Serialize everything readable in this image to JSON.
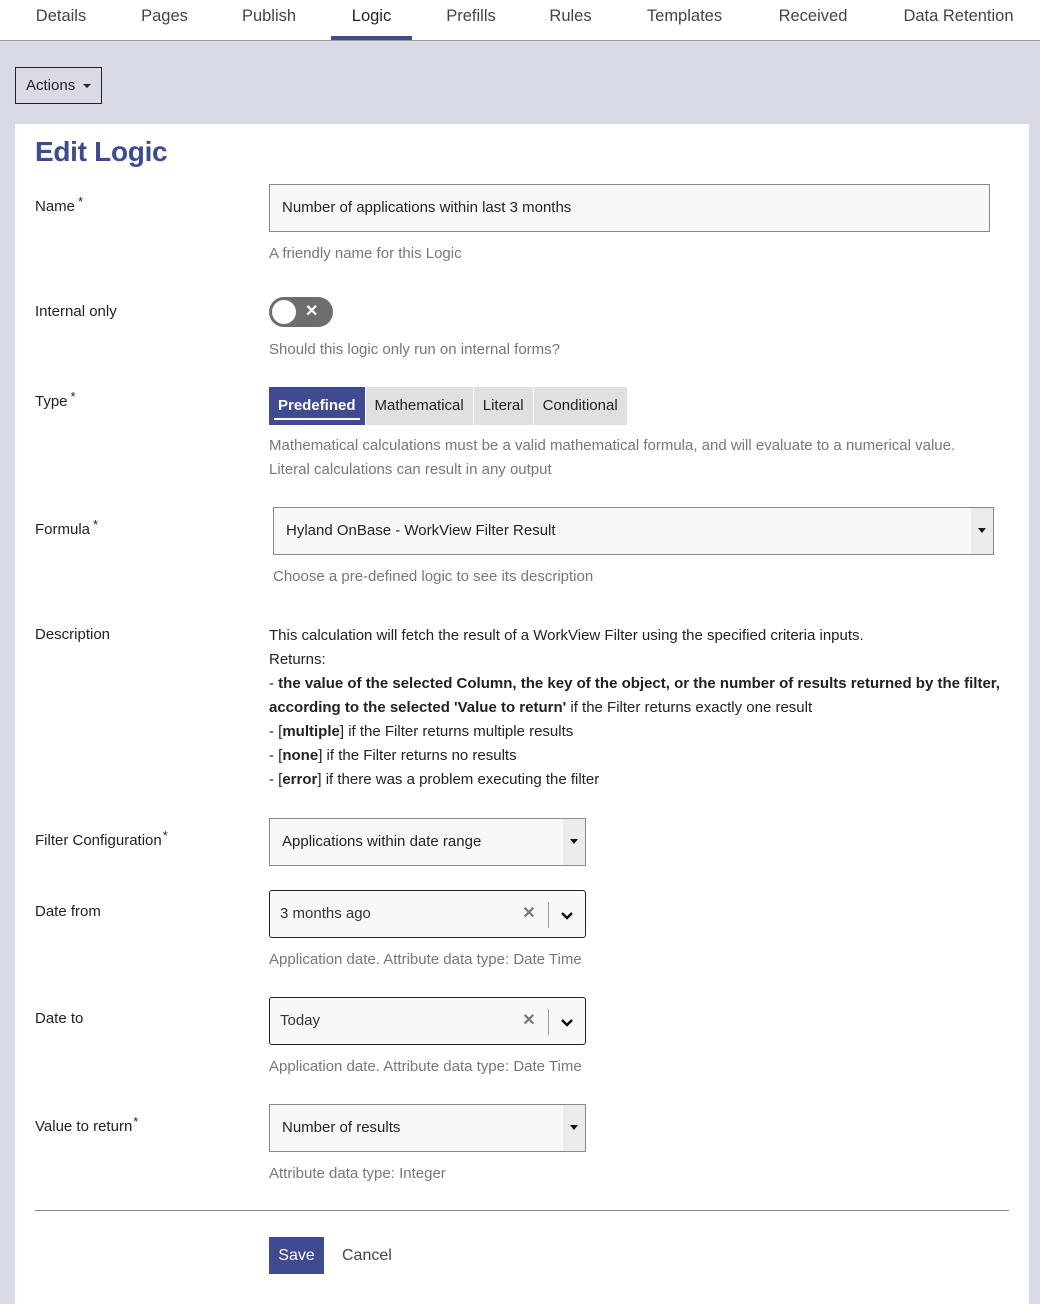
{
  "tabs": [
    {
      "label": "Details",
      "active": false
    },
    {
      "label": "Pages",
      "active": false
    },
    {
      "label": "Publish",
      "active": false
    },
    {
      "label": "Logic",
      "active": true
    },
    {
      "label": "Prefills",
      "active": false
    },
    {
      "label": "Rules",
      "active": false
    },
    {
      "label": "Templates",
      "active": false
    },
    {
      "label": "Received",
      "active": false
    },
    {
      "label": "Data Retention",
      "active": false
    }
  ],
  "actions_label": "Actions",
  "form": {
    "title": "Edit Logic",
    "required_marker": "*",
    "name": {
      "label": "Name",
      "value": "Number of applications within last 3 months",
      "help": "A friendly name for this Logic"
    },
    "internal_only": {
      "label": "Internal only",
      "checked": false,
      "off_glyph": "✕",
      "help": "Should this logic only run on internal forms?"
    },
    "type": {
      "label": "Type",
      "options": [
        "Predefined",
        "Mathematical",
        "Literal",
        "Conditional"
      ],
      "selected": "Predefined",
      "help_lines": [
        "Mathematical calculations must be a valid mathematical formula, and will evaluate to a numerical value.",
        "Literal calculations can result in any output"
      ]
    },
    "formula": {
      "label": "Formula",
      "value": "Hyland OnBase - WorkView Filter Result",
      "help": "Choose a pre-defined logic to see its description"
    },
    "description": {
      "label": "Description",
      "intro": "This calculation will fetch the result of a WorkView Filter using the specified criteria inputs.",
      "returns_label": "Returns:",
      "item1_bold": "the value of the selected Column, the key of the object, or the number of results returned by the filter, according to the selected 'Value to return'",
      "item1_rest": " if the Filter returns exactly one result",
      "item2_bold": "multiple",
      "item2_rest": " if the Filter returns multiple results",
      "item3_bold": "none",
      "item3_rest": " if the Filter returns no results",
      "item4_bold": "error",
      "item4_rest": " if there was a problem executing the filter"
    },
    "filter_configuration": {
      "label": "Filter Configuration",
      "value": "Applications within date range"
    },
    "date_from": {
      "label": "Date from",
      "value": "3 months ago",
      "help": "Application date. Attribute data type: Date Time"
    },
    "date_to": {
      "label": "Date to",
      "value": "Today",
      "help": "Application date. Attribute data type: Date Time"
    },
    "value_to_return": {
      "label": "Value to return",
      "value": "Number of results",
      "help": "Attribute data type: Integer"
    },
    "save_label": "Save",
    "cancel_label": "Cancel"
  },
  "colors": {
    "accent": "#3f4a90",
    "page_bg": "#d8dae6",
    "toggle_off": "#6d6d6d"
  }
}
